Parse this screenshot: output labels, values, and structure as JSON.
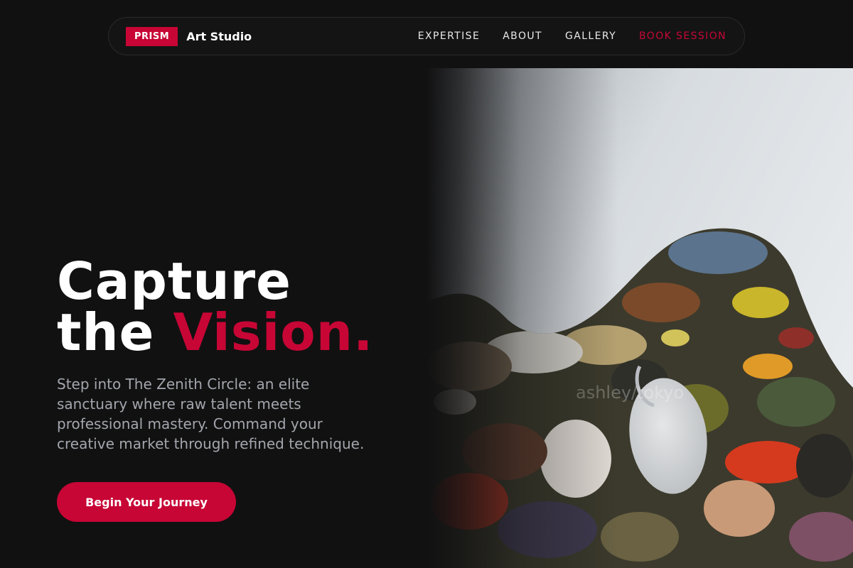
{
  "brand": {
    "badge": "PRISM",
    "name": "Art Studio"
  },
  "nav": {
    "links": [
      {
        "label": "EXPERTISE"
      },
      {
        "label": "ABOUT"
      },
      {
        "label": "GALLERY"
      },
      {
        "label": "BOOK SESSION"
      }
    ]
  },
  "hero": {
    "headline_line1": "Capture",
    "headline_line2_prefix": "the ",
    "headline_line2_accent": "Vision.",
    "subtext": "Step into The Zenith Circle: an elite sanctuary where raw talent meets professional mastery. Command your creative market through refined technique.",
    "cta_label": "Begin Your Journey",
    "image_watermark": "ashley/tokyo"
  },
  "colors": {
    "accent": "#c70636",
    "background": "#111112",
    "muted_text": "#a4a6ad"
  }
}
